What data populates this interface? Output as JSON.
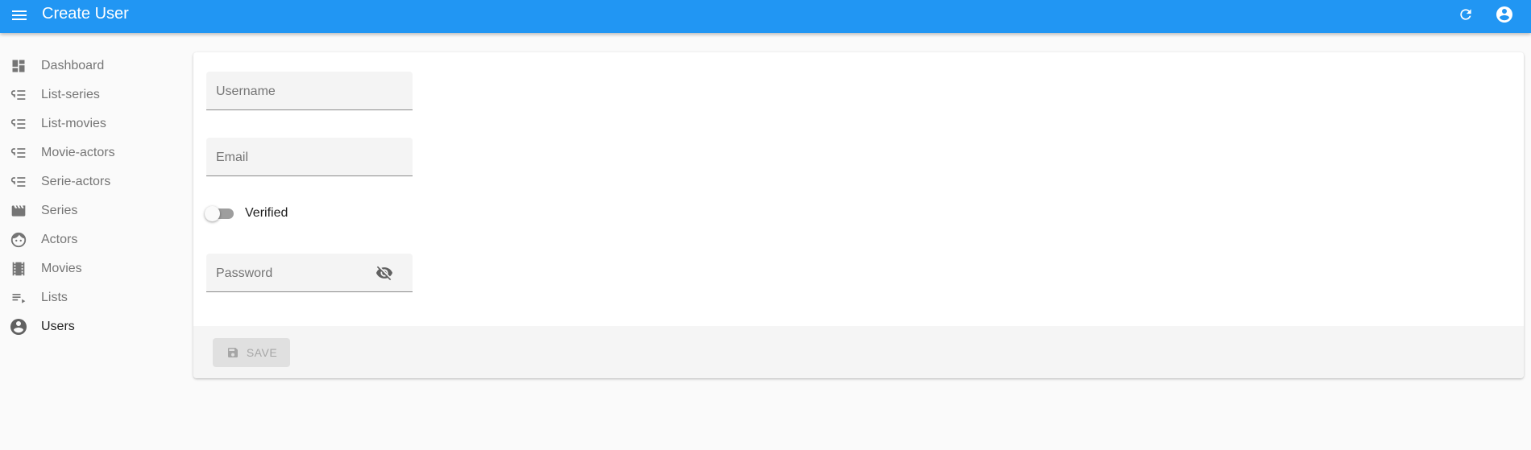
{
  "header": {
    "title": "Create User",
    "menu_icon": "menu-icon",
    "refresh_icon": "refresh-icon",
    "account_icon": "account-circle-icon",
    "background_color": "#2196f3"
  },
  "sidebar": {
    "items": [
      {
        "label": "Dashboard",
        "icon": "dashboard-icon",
        "active": false
      },
      {
        "label": "List-series",
        "icon": "list-icon",
        "active": false
      },
      {
        "label": "List-movies",
        "icon": "list-icon",
        "active": false
      },
      {
        "label": "Movie-actors",
        "icon": "list-icon",
        "active": false
      },
      {
        "label": "Serie-actors",
        "icon": "list-icon",
        "active": false
      },
      {
        "label": "Series",
        "icon": "movie-clapper-icon",
        "active": false
      },
      {
        "label": "Actors",
        "icon": "face-icon",
        "active": false
      },
      {
        "label": "Movies",
        "icon": "film-strip-icon",
        "active": false
      },
      {
        "label": "Lists",
        "icon": "playlist-icon",
        "active": false
      },
      {
        "label": "Users",
        "icon": "account-circle-icon",
        "active": true
      }
    ]
  },
  "form": {
    "username": {
      "placeholder": "Username",
      "value": ""
    },
    "email": {
      "placeholder": "Email",
      "value": ""
    },
    "verified": {
      "label": "Verified",
      "checked": false
    },
    "password": {
      "placeholder": "Password",
      "value": "",
      "toggle_icon": "visibility-off-icon"
    }
  },
  "toolbar": {
    "save_label": "SAVE",
    "save_icon": "save-icon",
    "save_disabled": true
  }
}
